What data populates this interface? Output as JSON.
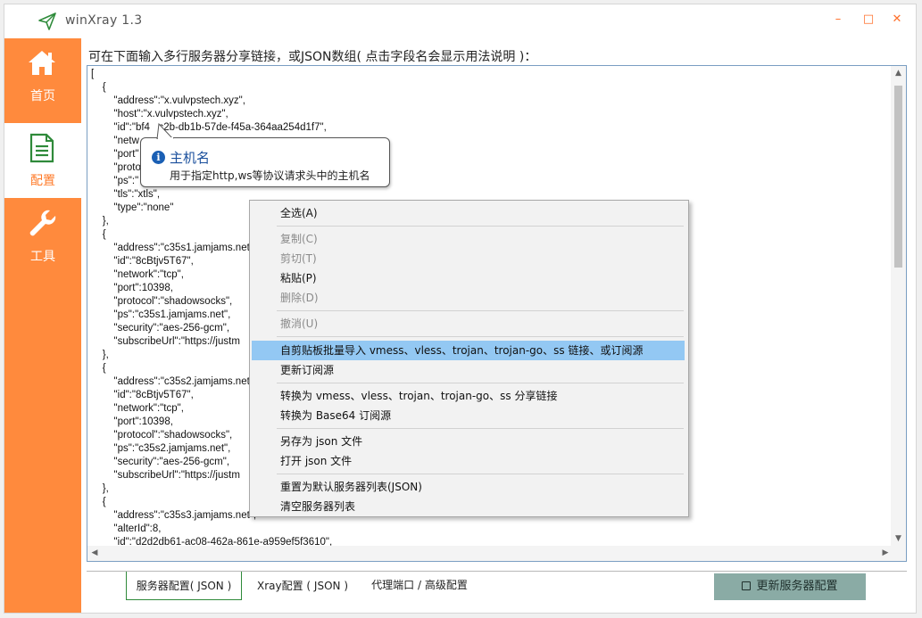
{
  "window": {
    "title": "winXray 1.3",
    "controls": {
      "minimize": "–",
      "maximize": "□",
      "close": "✕"
    }
  },
  "sidebar": {
    "items": [
      {
        "label": "首页",
        "icon": "home-icon",
        "active": false
      },
      {
        "label": "配置",
        "icon": "document-icon",
        "active": true
      },
      {
        "label": "工具",
        "icon": "wrench-icon",
        "active": false
      }
    ]
  },
  "main": {
    "instruction": "可在下面输入多行服务器分享链接，或JSON数组( 点击字段名会显示用法说明 )：",
    "editor_lines": [
      "[",
      "    {",
      "        \"address\":\"x.vulvpstech.xyz\",",
      "        \"host\":\"x.vulvpstech.xyz\",",
      "        \"id\":\"bf4   c2b-db1b-57de-f45a-364aa254d1f7\",",
      "        \"netw",
      "        \"port\"",
      "        \"proto",
      "        \"ps\":\"",
      "        \"tls\":\"xtls\",",
      "        \"type\":\"none\"",
      "    },",
      "    {",
      "        \"address\":\"c35s1.jamjams.net",
      "        \"id\":\"8cBtjv5T67\",",
      "        \"network\":\"tcp\",",
      "        \"port\":10398,",
      "        \"protocol\":\"shadowsocks\",",
      "        \"ps\":\"c35s1.jamjams.net\",",
      "        \"security\":\"aes-256-gcm\",",
      "        \"subscribeUrl\":\"https://justm                                                                                                                                  510\"",
      "    },",
      "    {",
      "        \"address\":\"c35s2.jamjams.net",
      "        \"id\":\"8cBtjv5T67\",",
      "        \"network\":\"tcp\",",
      "        \"port\":10398,",
      "        \"protocol\":\"shadowsocks\",",
      "        \"ps\":\"c35s2.jamjams.net\",",
      "        \"security\":\"aes-256-gcm\",",
      "        \"subscribeUrl\":\"https://justm                                                                                                                                  510\"",
      "    },",
      "    {",
      "        \"address\":\"c35s3.jamjams.net\",",
      "        \"alterId\":8,",
      "        \"id\":\"d2d2db61-ac08-462a-861e-a959ef5f3610\","
    ]
  },
  "tooltip": {
    "title": "主机名",
    "description": "用于指定http,ws等协议请求头中的主机名"
  },
  "context_menu": {
    "items": [
      {
        "label": "全选(A)",
        "disabled": false
      },
      {
        "label": "复制(C)",
        "disabled": true
      },
      {
        "label": "剪切(T)",
        "disabled": true
      },
      {
        "label": "粘贴(P)",
        "disabled": false
      },
      {
        "label": "删除(D)",
        "disabled": true
      },
      {
        "label": "撤消(U)",
        "disabled": true
      },
      {
        "label": "自剪贴板批量导入 vmess、vless、trojan、trojan-go、ss 链接、或订阅源",
        "disabled": false,
        "highlighted": true
      },
      {
        "label": "更新订阅源",
        "disabled": false
      },
      {
        "label": "转换为 vmess、vless、trojan、trojan-go、ss 分享链接",
        "disabled": false
      },
      {
        "label": "转换为 Base64 订阅源",
        "disabled": false
      },
      {
        "label": "另存为 json 文件",
        "disabled": false
      },
      {
        "label": "打开 json 文件",
        "disabled": false
      },
      {
        "label": "重置为默认服务器列表(JSON)",
        "disabled": false
      },
      {
        "label": "清空服务器列表",
        "disabled": false
      }
    ]
  },
  "tabs": [
    {
      "label": "服务器配置( JSON )",
      "active": true
    },
    {
      "label": "Xray配置 ( JSON )",
      "active": false
    },
    {
      "label": "代理端口 / 高级配置",
      "active": false
    }
  ],
  "update_button": {
    "label": "更新服务器配置",
    "icon": "save-icon"
  },
  "colors": {
    "accent": "#ff8a3d",
    "highlight": "#93c8f3",
    "tab_border": "#2f8a3a",
    "button": "#8aaba5"
  }
}
